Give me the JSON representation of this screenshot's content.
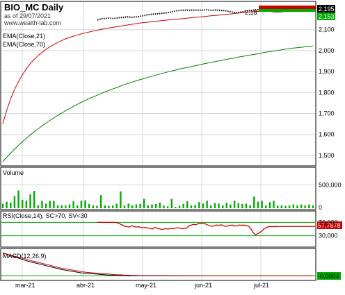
{
  "header": {
    "title": "BIO_MC Daily",
    "subtitle": "as of 29/07/2021",
    "website": "www.wealth-lab.com"
  },
  "colors": {
    "ema21": "#cc0000",
    "ema70": "#008000",
    "volume": "#00aa00",
    "rsi": "#cc0000",
    "macd": "#000000",
    "signal": "#cc0000",
    "price_box_red": "#cc0000",
    "price_box_green": "#00aa00",
    "price_box_black": "#000000",
    "grid": "#d8d8d8"
  },
  "chart_data": [
    {
      "type": "line",
      "panel": "price",
      "legend": [
        "EMA(Close,21)",
        "EMA(Close,70)"
      ],
      "ylim": [
        1460,
        2215
      ],
      "y_ticks": [
        "2,100",
        "2,000",
        "1,900",
        "1,800",
        "1,700",
        "1,600",
        "1,500"
      ],
      "x_ticks": [
        "mar-21",
        "abr-21",
        "may-21",
        "jun-21",
        "jul-21"
      ],
      "price_labels": [
        "2,195",
        "2,153"
      ],
      "annotation": "2,18",
      "series": [
        {
          "name": "EMA(Close,21)",
          "color": "#cc0000",
          "values": [
            1650,
            1715,
            1770,
            1815,
            1852,
            1885,
            1913,
            1937,
            1958,
            1976,
            1992,
            2006,
            2018,
            2029,
            2039,
            2048,
            2056,
            2063,
            2069,
            2075,
            2080,
            2085,
            2089,
            2093,
            2097,
            2101,
            2105,
            2108,
            2111,
            2114,
            2117,
            2120,
            2123,
            2126,
            2129,
            2132,
            2134,
            2136,
            2138,
            2140,
            2142,
            2144,
            2146,
            2147,
            2149,
            2151,
            2153,
            2155,
            2157,
            2159,
            2160,
            2162,
            2164,
            2166,
            2168,
            2169,
            2171,
            2173,
            2175,
            2177,
            2179,
            2181,
            2183,
            2185,
            2186,
            2187,
            2188,
            2188,
            2187,
            2185,
            2184,
            2185,
            2187,
            2189,
            2190,
            2192,
            2193,
            2194,
            2195,
            2196
          ]
        },
        {
          "name": "EMA(Close,70)",
          "color": "#008000",
          "values": [
            1470,
            1491,
            1511,
            1530,
            1548,
            1566,
            1582,
            1598,
            1613,
            1627,
            1641,
            1654,
            1667,
            1679,
            1691,
            1702,
            1713,
            1724,
            1734,
            1744,
            1753,
            1762,
            1771,
            1779,
            1787,
            1795,
            1803,
            1810,
            1817,
            1824,
            1831,
            1838,
            1844,
            1850,
            1856,
            1862,
            1867,
            1873,
            1878,
            1883,
            1888,
            1893,
            1898,
            1903,
            1907,
            1912,
            1916,
            1920,
            1924,
            1928,
            1932,
            1936,
            1940,
            1944,
            1947,
            1951,
            1955,
            1958,
            1962,
            1965,
            1969,
            1972,
            1976,
            1979,
            1982,
            1985,
            1989,
            1992,
            1995,
            1998,
            2001,
            2004,
            2007,
            2009,
            2012,
            2014,
            2016,
            2018,
            2020,
            2022
          ]
        }
      ],
      "close_dots": [
        2147,
        2150,
        2152,
        2153,
        2154,
        2155,
        2154,
        2153,
        2154,
        2155,
        2157,
        2158,
        2159,
        2160,
        2161,
        2160,
        2159,
        2160,
        2161,
        2162,
        2164,
        2166,
        2168,
        2170,
        2172,
        2173,
        2174,
        2175,
        2176,
        2177,
        2178,
        2179,
        2180,
        2182,
        2184,
        2186,
        2188,
        2190,
        2191,
        2192,
        2193,
        2193,
        2193,
        2192,
        2193,
        2193,
        2193,
        2193,
        2193,
        2193,
        2194,
        2194,
        2193,
        2192,
        2193,
        2193,
        2193,
        2192,
        2191,
        2191,
        2190,
        2188,
        2186,
        2184,
        2182,
        2181,
        2182,
        2184,
        2186,
        2188,
        2190,
        2191,
        2192,
        2193,
        2194,
        2195
      ]
    },
    {
      "type": "bar",
      "panel": "volume",
      "title": "Volume",
      "ylim": [
        0,
        800000
      ],
      "y_ticks": [
        "500,000",
        "0"
      ],
      "values": [
        95000,
        140000,
        120000,
        260000,
        380000,
        180000,
        160000,
        300000,
        370000,
        60000,
        160000,
        100000,
        160000,
        160000,
        60000,
        60000,
        60000,
        80000,
        150000,
        60000,
        160000,
        170000,
        90000,
        60000,
        50000,
        280000,
        60000,
        50000,
        60000,
        100000,
        360000,
        60000,
        100000,
        60000,
        80000,
        90000,
        200000,
        60000,
        80000,
        90000,
        120000,
        60000,
        40000,
        200000,
        30000,
        50000,
        90000,
        150000,
        60000,
        70000,
        130000,
        100000,
        160000,
        60000,
        110000,
        100000,
        60000,
        120000,
        80000,
        160000,
        110000,
        90000,
        100000,
        60000,
        250000,
        140000,
        160000,
        60000,
        130000,
        160000,
        50000,
        60000,
        50000,
        60000,
        80000,
        60000,
        80000,
        60000,
        80000,
        60000
      ]
    },
    {
      "type": "line",
      "panel": "rsi",
      "title": "RSI(Close,14), SC>70, SV<30",
      "ylim": [
        0,
        100
      ],
      "y_ticks": [
        "70,000",
        "30,000"
      ],
      "value_label": "57,7878",
      "series": [
        {
          "name": "RSI(Close,14)",
          "color": "#cc0000",
          "values": [
            70,
            70,
            70,
            70,
            70,
            70,
            70,
            70,
            70,
            68,
            65,
            62,
            58,
            57,
            56,
            60,
            58,
            56,
            57,
            55,
            54,
            55,
            53,
            52,
            50,
            55,
            53,
            51,
            49,
            50,
            51,
            50,
            52,
            51,
            53,
            54,
            53,
            51,
            52,
            53,
            60,
            62,
            64,
            63,
            66,
            67,
            68,
            66,
            63,
            60,
            58,
            60,
            62,
            61,
            63,
            60,
            58,
            60,
            61,
            62,
            59,
            60,
            62,
            61,
            62,
            60,
            59,
            52,
            40,
            33,
            36,
            40,
            45,
            52,
            55,
            58,
            57,
            57,
            58,
            57
          ]
        }
      ]
    },
    {
      "type": "line",
      "panel": "macd",
      "title": "MACD(12,26,9)",
      "ylim": [
        -0.01,
        0.075
      ],
      "value_label": "-0,0004",
      "series": [
        {
          "name": "MACD(12,26,9)",
          "color": "#000000",
          "values": [
            0.07,
            0.066,
            0.062,
            0.058,
            0.054,
            0.05,
            0.046,
            0.043,
            0.04,
            0.037,
            0.034,
            0.031,
            0.028,
            0.025,
            0.022,
            0.019,
            0.017,
            0.015,
            0.013,
            0.011,
            0.009,
            0.008,
            0.007,
            0.006,
            0.005,
            0.004,
            0.003,
            0.002,
            0.002,
            0.001,
            0.001,
            0.0005,
            0.0003,
            0.0002,
            0.0001,
            0,
            0,
            -0.0001,
            -0.0001,
            -0.0002,
            -0.0002,
            -0.0002,
            -0.0003,
            -0.0003,
            -0.0003,
            -0.0003,
            -0.0004,
            -0.0004,
            -0.0004,
            -0.0004,
            -0.0004,
            -0.0004,
            -0.0004,
            -0.0004,
            -0.0004,
            -0.0004,
            -0.0004,
            -0.0004,
            -0.0004,
            -0.0004,
            -0.0004,
            -0.0004,
            -0.0004,
            -0.0004,
            -0.0004,
            -0.0004,
            -0.0004,
            -0.0004,
            -0.0004,
            -0.0004,
            -0.0004,
            -0.0004,
            -0.0004,
            -0.0004,
            -0.0004,
            -0.0004,
            -0.0004,
            -0.0004,
            -0.0004,
            -0.0004
          ]
        },
        {
          "name": "Signal",
          "color": "#cc0000",
          "values": [
            0.068,
            0.066,
            0.063,
            0.06,
            0.057,
            0.054,
            0.051,
            0.047,
            0.044,
            0.041,
            0.038,
            0.035,
            0.032,
            0.029,
            0.026,
            0.023,
            0.021,
            0.019,
            0.017,
            0.015,
            0.013,
            0.011,
            0.01,
            0.009,
            0.008,
            0.007,
            0.006,
            0.005,
            0.004,
            0.003,
            0.003,
            0.002,
            0.002,
            0.001,
            0.001,
            0.0005,
            0.0003,
            0.0002,
            0.0001,
            0,
            0,
            -0.0001,
            -0.0001,
            -0.0002,
            -0.0002,
            -0.0002,
            -0.0003,
            -0.0003,
            -0.0003,
            -0.0003,
            -0.0003,
            -0.0004,
            -0.0004,
            -0.0004,
            -0.0004,
            -0.0004,
            -0.0004,
            -0.0004,
            -0.0004,
            -0.0004,
            -0.0004,
            -0.0004,
            -0.0004,
            -0.0004,
            -0.0004,
            -0.0004,
            -0.0004,
            -0.0004,
            -0.0004,
            -0.0004,
            -0.0004,
            -0.0004,
            -0.0004,
            -0.0004,
            -0.0004,
            -0.0004,
            -0.0004,
            -0.0004,
            -0.0004,
            -0.0004
          ]
        }
      ],
      "histogram": [
        0.002,
        0.0015,
        0.001,
        0.001,
        0.001,
        0.0008,
        0.0006,
        0.0005,
        0.0004,
        0.0003,
        0.0002,
        0.0002,
        0.0001,
        0.0001,
        0.0001,
        0.0001,
        0.0001,
        0.0001,
        0.0001,
        0.0001,
        0.0001,
        0.0001,
        0.0001,
        0.0001,
        0.0001,
        0.0001,
        0.0001,
        0.0001,
        0.0001,
        0.0001,
        0.0001,
        0.0001,
        0.0001,
        0.0001,
        0.0001,
        0.0001,
        0.0001,
        0.0001,
        0.0001,
        0.0001,
        0.0001,
        0.0001,
        0.0001,
        0.0001,
        0.0001,
        0.0001,
        0.0001,
        0.0001,
        0.0001,
        0.0001,
        0.0001,
        0.0001,
        0.0001,
        0.0001,
        0.0001,
        0.0001,
        0.0001,
        0.0001,
        0.0001,
        0.0001,
        0.0001,
        0.0001,
        0.0001,
        0.0001,
        0.0001,
        0.0001,
        0.0001,
        0.0001,
        0.0001,
        0.0001,
        0.0001,
        0.0001,
        0.0001,
        0.0001,
        0.0001,
        0.0001,
        0.0001,
        0.0001,
        0.0001,
        0.0001
      ]
    }
  ]
}
